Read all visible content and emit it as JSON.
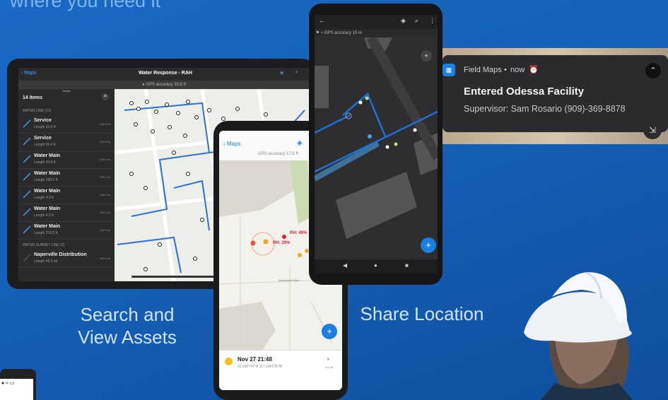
{
  "headline": "where you need it",
  "captions": {
    "search_line1": "Search and",
    "search_line2": "View Assets",
    "share": "Share Location"
  },
  "tablet": {
    "back_label": "Maps",
    "title": "Water Response - RAH",
    "gps": "GPS accuracy 33.8 ft",
    "items_count": "14 items",
    "section1": "WATER LINE (12)",
    "section2": "WATER SUBNET LINE (2)",
    "rows": [
      {
        "title": "Service",
        "sub": "Length 10.6 ft",
        "dist": "106 ft mi"
      },
      {
        "title": "Service",
        "sub": "Length 66.4 ft",
        "dist": "106 ft mi"
      },
      {
        "title": "Water Main",
        "sub": "Length 92.8 ft",
        "dist": "106 ft mi"
      },
      {
        "title": "Water Main",
        "sub": "Length 299.5 ft",
        "dist": "106 ft mi"
      },
      {
        "title": "Water Main",
        "sub": "Length 4.0 ft",
        "dist": "106 ft mi"
      },
      {
        "title": "Water Main",
        "sub": "Length 4.2 ft",
        "dist": "106 ft mi"
      },
      {
        "title": "Water Main",
        "sub": "Length 210.5 ft",
        "dist": "106 ft mi"
      }
    ],
    "subnet_row": {
      "title": "Naperville Distribution",
      "sub": "Length 46.5 mi",
      "dist": "406 ft mi"
    }
  },
  "phone_center": {
    "back_label": "Maps",
    "gps": "GPS accuracy 17.5 ft",
    "rh1": "RH: 49%",
    "rh2": "RH: 29%",
    "street": "Alessandro Blvd",
    "card_title": "Nov 27 21:48",
    "card_coords": "33.930747°N 117.130176°W",
    "card_dist": "3.6 mi"
  },
  "phone_right": {
    "gps": "GPS accuracy 10 m",
    "fab": "+"
  },
  "notification": {
    "app": "Field Maps",
    "time": "now",
    "title": "Entered Odessa Facility",
    "body": "Supervisor: Sam Rosario (909)-369-8878"
  },
  "colors": {
    "accent": "#1a7fe0",
    "background": "#1560b8"
  }
}
